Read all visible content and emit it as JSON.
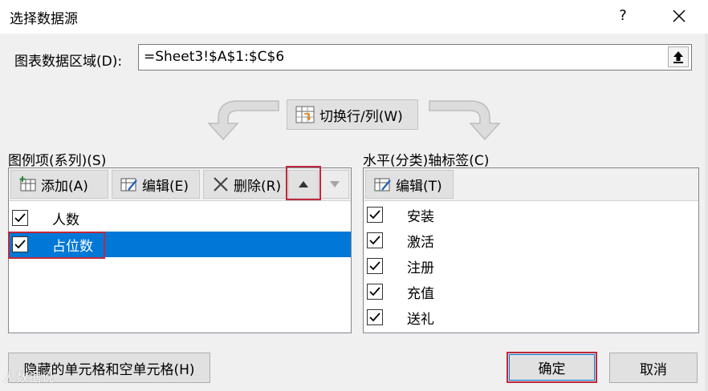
{
  "window": {
    "title": "选择数据源",
    "help_label": "?"
  },
  "range": {
    "label": "图表数据区域(D):",
    "value": "=Sheet3!$A$1:$C$6"
  },
  "switch_button": {
    "label": "切换行/列(W)"
  },
  "legend": {
    "label": "图例项(系列)(S)",
    "toolbar": {
      "add_label": "添加(A)",
      "edit_label": "编辑(E)",
      "delete_label": "删除(R)"
    },
    "items": [
      {
        "label": "人数",
        "checked": true,
        "selected": false
      },
      {
        "label": "占位数",
        "checked": true,
        "selected": true
      }
    ]
  },
  "axis": {
    "label": "水平(分类)轴标签(C)",
    "toolbar": {
      "edit_label": "编辑(T)"
    },
    "items": [
      {
        "label": "安装",
        "checked": true
      },
      {
        "label": "激活",
        "checked": true
      },
      {
        "label": "注册",
        "checked": true
      },
      {
        "label": "充值",
        "checked": true
      },
      {
        "label": "送礼",
        "checked": true
      }
    ]
  },
  "footer": {
    "hidden_cells_label": "隐藏的单元格和空单元格(H)",
    "ok_label": "确定",
    "cancel_label": "取消"
  },
  "watermark": "人数据说",
  "colors": {
    "selection": "#0078d7",
    "highlight": "#c0283a"
  }
}
